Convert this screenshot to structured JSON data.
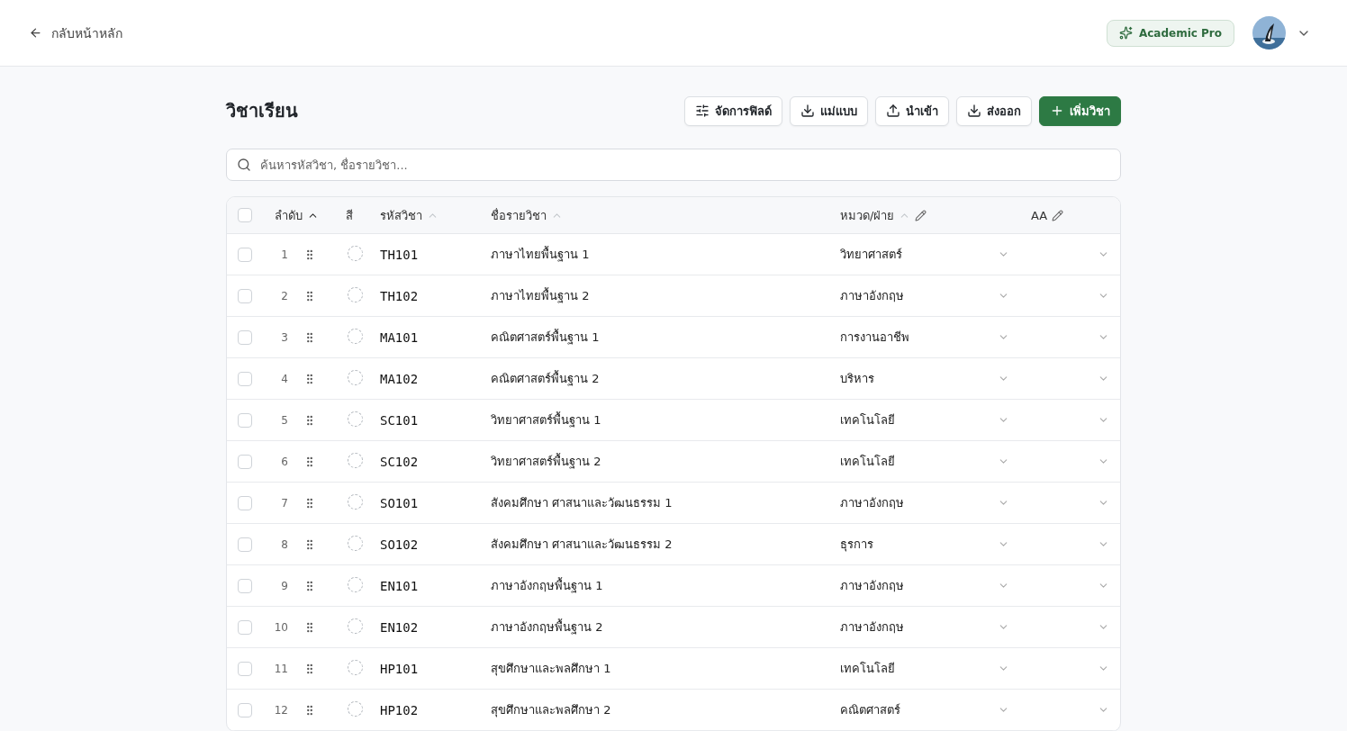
{
  "topbar": {
    "back_link": "กลับหน้าหลัก",
    "plan_badge": "Academic Pro"
  },
  "page": {
    "title": "วิชาเรียน",
    "actions": [
      {
        "label": "จัดการฟิลด์",
        "kind": "fields",
        "primary": false
      },
      {
        "label": "แม่แบบ",
        "kind": "download",
        "primary": false
      },
      {
        "label": "นำเข้า",
        "kind": "upload",
        "primary": false
      },
      {
        "label": "ส่งออก",
        "kind": "download",
        "primary": false
      },
      {
        "label": "เพิ่มวิชา",
        "kind": "add",
        "primary": true
      }
    ],
    "search": {
      "placeholder": "ค้นหารหัสวิชา, ชื่อรายวิชา..."
    }
  },
  "table": {
    "select_all_checked": false,
    "columns": [
      {
        "label": "ลำดับ",
        "sortable": true,
        "sort_active": true,
        "editable": false
      },
      {
        "label": "สี",
        "sortable": false,
        "editable": false
      },
      {
        "label": "รหัสวิชา",
        "sortable": true,
        "sort_active": false,
        "editable": false
      },
      {
        "label": "ชื่อรายวิชา",
        "sortable": true,
        "sort_active": false,
        "editable": false
      },
      {
        "label": "หมวด/ฝ่าย",
        "sortable": true,
        "sort_active": false,
        "editable": true
      },
      {
        "label": "AA",
        "sortable": false,
        "editable": true
      }
    ],
    "rows": [
      {
        "checked": false,
        "order": "1",
        "code": "TH101",
        "name": "ภาษาไทยพื้นฐาน 1",
        "category": "วิทยาศาสตร์"
      },
      {
        "checked": false,
        "order": "2",
        "code": "TH102",
        "name": "ภาษาไทยพื้นฐาน 2",
        "category": "ภาษาอังกฤษ"
      },
      {
        "checked": false,
        "order": "3",
        "code": "MA101",
        "name": "คณิตศาสตร์พื้นฐาน 1",
        "category": "การงานอาชีพ"
      },
      {
        "checked": false,
        "order": "4",
        "code": "MA102",
        "name": "คณิตศาสตร์พื้นฐาน 2",
        "category": "บริหาร"
      },
      {
        "checked": false,
        "order": "5",
        "code": "SC101",
        "name": "วิทยาศาสตร์พื้นฐาน 1",
        "category": "เทคโนโลยี"
      },
      {
        "checked": false,
        "order": "6",
        "code": "SC102",
        "name": "วิทยาศาสตร์พื้นฐาน 2",
        "category": "เทคโนโลยี"
      },
      {
        "checked": false,
        "order": "7",
        "code": "SO101",
        "name": "สังคมศึกษา ศาสนาและวัฒนธรรม 1",
        "category": "ภาษาอังกฤษ"
      },
      {
        "checked": false,
        "order": "8",
        "code": "SO102",
        "name": "สังคมศึกษา ศาสนาและวัฒนธรรม 2",
        "category": "ธุรการ"
      },
      {
        "checked": false,
        "order": "9",
        "code": "EN101",
        "name": "ภาษาอังกฤษพื้นฐาน 1",
        "category": "ภาษาอังกฤษ"
      },
      {
        "checked": false,
        "order": "10",
        "code": "EN102",
        "name": "ภาษาอังกฤษพื้นฐาน 2",
        "category": "ภาษาอังกฤษ"
      },
      {
        "checked": false,
        "order": "11",
        "code": "HP101",
        "name": "สุขศึกษาและพลศึกษา 1",
        "category": "เทคโนโลยี"
      },
      {
        "checked": false,
        "order": "12",
        "code": "HP102",
        "name": "สุขศึกษาและพลศึกษา 2",
        "category": "คณิตศาสตร์"
      }
    ]
  }
}
